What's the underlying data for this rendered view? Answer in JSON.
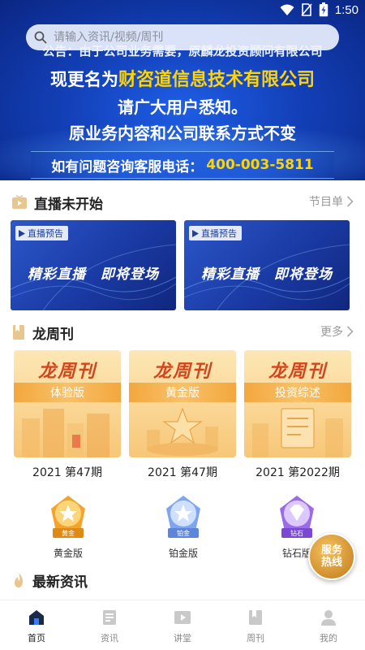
{
  "status_bar": {
    "time": "1:50"
  },
  "search": {
    "placeholder": "请输入资讯/视频/周刊"
  },
  "banner": {
    "notice": "公告：由于公司业务需要，原麟龙投资顾问有限公司",
    "rename_prefix": "现更名为",
    "new_company": "财咨道信息技术有限公司",
    "inform": "请广大用户悉知。",
    "business": "原业务内容和公司联系方式不变",
    "hotline_label": "如有问题咨询客服电话：",
    "hotline_number": "400-003-5811"
  },
  "live": {
    "title": "直播未开始",
    "more": "节目单",
    "cards": [
      {
        "tag": "直播预告",
        "slogan": "精彩直播　即将登场"
      },
      {
        "tag": "直播预告",
        "slogan": "精彩直播　即将登场"
      }
    ]
  },
  "weekly": {
    "title": "龙周刊",
    "more": "更多",
    "cards": [
      {
        "brand": "龙周刊",
        "edition": "体验版",
        "issue": "2021 第47期"
      },
      {
        "brand": "龙周刊",
        "edition": "黄金版",
        "issue": "2021 第47期"
      },
      {
        "brand": "龙周刊",
        "edition": "投资综述",
        "issue": "2021 第2022期"
      }
    ]
  },
  "badges": [
    {
      "badge_text": "黄金",
      "label": "黄金版",
      "color": "#f2a42c"
    },
    {
      "badge_text": "铂金",
      "label": "铂金版",
      "color": "#7ea6ef"
    },
    {
      "badge_text": "钻石",
      "label": "钻石版",
      "color": "#9b6be8"
    }
  ],
  "news": {
    "title": "最新资讯"
  },
  "service_button": {
    "line1": "服务",
    "line2": "热线"
  },
  "bottom_nav": [
    {
      "label": "首页",
      "icon": "home-icon",
      "active": true
    },
    {
      "label": "资讯",
      "icon": "news-icon",
      "active": false
    },
    {
      "label": "讲堂",
      "icon": "video-icon",
      "active": false
    },
    {
      "label": "周刊",
      "icon": "book-icon",
      "active": false
    },
    {
      "label": "我的",
      "icon": "person-icon",
      "active": false
    }
  ],
  "colors": {
    "accent": "#1a3aa4",
    "highlight": "#ffd400",
    "weekly_title": "#d2461d"
  }
}
